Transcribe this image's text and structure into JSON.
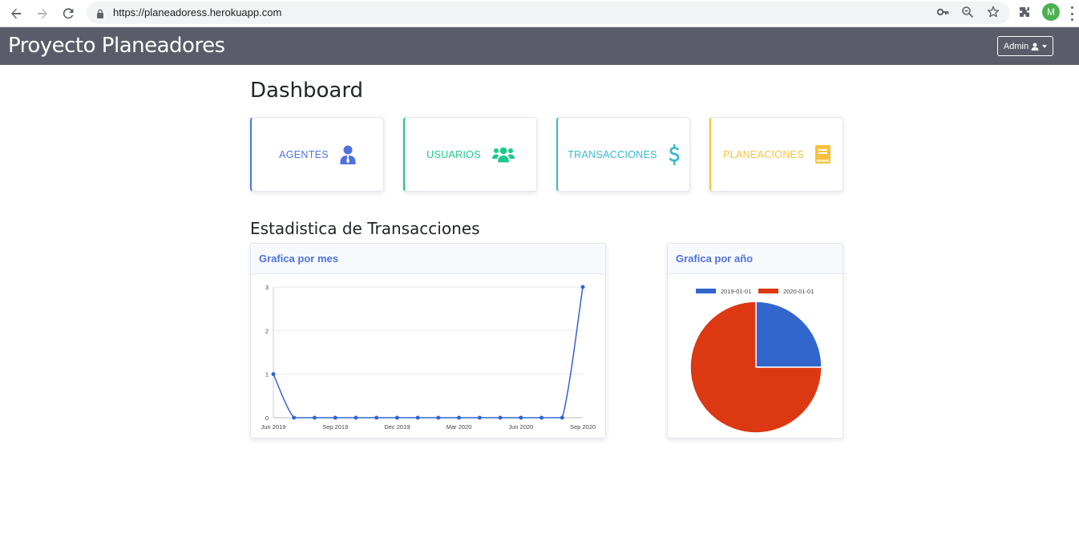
{
  "browser": {
    "url": "https://planeadoress.herokuapp.com",
    "profile_initial": "M",
    "icons": [
      "back-icon",
      "forward-icon",
      "reload-icon",
      "lock-icon",
      "key-icon",
      "zoom-icon",
      "star-icon",
      "extensions-icon",
      "menu-icon"
    ]
  },
  "navbar": {
    "brand": "Proyecto Planeadores",
    "admin_label": "Admin"
  },
  "dashboard": {
    "title": "Dashboard",
    "cards": [
      {
        "label": "AGENTES",
        "color": "#4e73df",
        "icon": "user-tie-icon"
      },
      {
        "label": "USUARIOS",
        "color": "#1cc88a",
        "icon": "users-icon"
      },
      {
        "label": "TRANSACCIONES",
        "color": "#36b9cc",
        "icon": "dollar-icon"
      },
      {
        "label": "PLANEACIONES",
        "color": "#f6c23e",
        "icon": "book-icon"
      }
    ]
  },
  "stats": {
    "title": "Estadistica de Transacciones",
    "month_panel_title": "Grafica por mes",
    "year_panel_title": "Grafica por año"
  },
  "chart_data": [
    {
      "type": "line",
      "title": "Grafica por mes",
      "x": [
        "2019-06",
        "2019-07",
        "2019-08",
        "2019-09",
        "2019-10",
        "2019-11",
        "2019-12",
        "2020-01",
        "2020-02",
        "2020-03",
        "2020-04",
        "2020-05",
        "2020-06",
        "2020-07",
        "2020-08",
        "2020-09"
      ],
      "x_tick_labels": [
        "Jun 2019",
        "Sep 2019",
        "Dec 2019",
        "Mar 2020",
        "Jun 2020",
        "Sep 2020"
      ],
      "x_tick_values": [
        "2019-06",
        "2019-09",
        "2019-12",
        "2020-03",
        "2020-06",
        "2020-09"
      ],
      "series": [
        {
          "values": [
            1,
            0,
            0,
            0,
            0,
            0,
            0,
            0,
            0,
            0,
            0,
            0,
            0,
            0,
            0,
            3
          ],
          "color": "#3366cc"
        }
      ],
      "y_ticks": [
        0,
        1,
        2,
        3
      ],
      "ylim": [
        0,
        3
      ],
      "grid": true
    },
    {
      "type": "pie",
      "title": "Grafica por año",
      "labels": [
        "2019-01-01",
        "2020-01-01"
      ],
      "values": [
        1,
        3
      ],
      "colors": [
        "#3366cc",
        "#dc3912"
      ],
      "legend": "top"
    }
  ]
}
